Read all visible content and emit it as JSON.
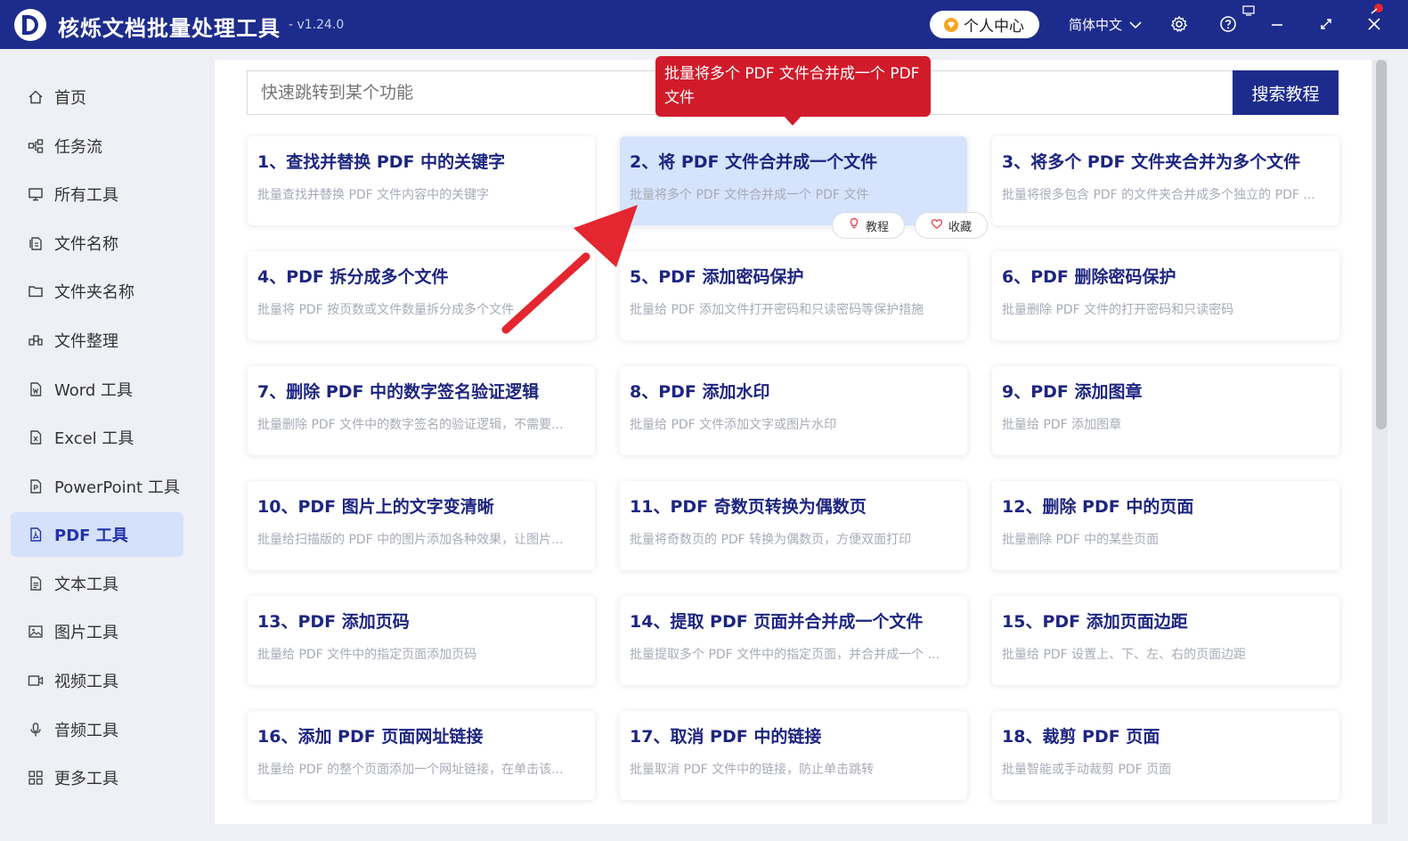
{
  "app": {
    "title": "核烁文档批量处理工具",
    "version": "- v1.24.0",
    "user_center": "个人中心",
    "language": "简体中文",
    "colors": {
      "brand": "#1d2c8c",
      "tooltip": "#d11b2b",
      "highlight": "#d5e3fc"
    }
  },
  "sidebar": {
    "items": [
      {
        "label": "首页",
        "icon": "home-icon"
      },
      {
        "label": "任务流",
        "icon": "workflow-icon"
      },
      {
        "label": "所有工具",
        "icon": "monitor-icon"
      },
      {
        "label": "文件名称",
        "icon": "file-name-icon"
      },
      {
        "label": "文件夹名称",
        "icon": "folder-icon"
      },
      {
        "label": "文件整理",
        "icon": "organize-icon"
      },
      {
        "label": "Word 工具",
        "icon": "word-icon"
      },
      {
        "label": "Excel 工具",
        "icon": "excel-icon"
      },
      {
        "label": "PowerPoint 工具",
        "icon": "powerpoint-icon"
      },
      {
        "label": "PDF 工具",
        "icon": "pdf-icon",
        "active": true
      },
      {
        "label": "文本工具",
        "icon": "text-icon"
      },
      {
        "label": "图片工具",
        "icon": "image-icon"
      },
      {
        "label": "视频工具",
        "icon": "video-icon"
      },
      {
        "label": "音频工具",
        "icon": "microphone-icon"
      },
      {
        "label": "更多工具",
        "icon": "grid-icon"
      }
    ]
  },
  "search": {
    "placeholder": "快速跳转到某个功能",
    "button_label": "搜索教程"
  },
  "tooltip": {
    "text": "批量将多个 PDF 文件合并成一个 PDF 文件"
  },
  "card_actions": {
    "tutorial_label": "教程",
    "favorite_label": "收藏"
  },
  "cards": [
    {
      "title": "1、查找并替换 PDF 中的关键字",
      "desc": "批量查找并替换 PDF 文件内容中的关键字"
    },
    {
      "title": "2、将 PDF 文件合并成一个文件",
      "desc": "批量将多个 PDF 文件合并成一个 PDF 文件",
      "highlighted": true
    },
    {
      "title": "3、将多个 PDF 文件夹合并为多个文件",
      "desc": "批量将很多包含 PDF 的文件夹合并成多个独立的 PDF ..."
    },
    {
      "title": "4、PDF 拆分成多个文件",
      "desc": "批量将 PDF 按页数或文件数量拆分成多个文件"
    },
    {
      "title": "5、PDF 添加密码保护",
      "desc": "批量给 PDF 添加文件打开密码和只读密码等保护措施"
    },
    {
      "title": "6、PDF 删除密码保护",
      "desc": "批量删除 PDF 文件的打开密码和只读密码"
    },
    {
      "title": "7、删除 PDF 中的数字签名验证逻辑",
      "desc": "批量删除 PDF 文件中的数字签名的验证逻辑，不需要..."
    },
    {
      "title": "8、PDF 添加水印",
      "desc": "批量给 PDF 文件添加文字或图片水印"
    },
    {
      "title": "9、PDF 添加图章",
      "desc": "批量给 PDF 添加图章"
    },
    {
      "title": "10、PDF 图片上的文字变清晰",
      "desc": "批量给扫描版的 PDF 中的图片添加各种效果，让图片..."
    },
    {
      "title": "11、PDF 奇数页转换为偶数页",
      "desc": "批量将奇数页的 PDF 转换为偶数页，方便双面打印"
    },
    {
      "title": "12、删除 PDF 中的页面",
      "desc": "批量删除 PDF 中的某些页面"
    },
    {
      "title": "13、PDF 添加页码",
      "desc": "批量给 PDF 文件中的指定页面添加页码"
    },
    {
      "title": "14、提取 PDF 页面并合并成一个文件",
      "desc": "批量提取多个 PDF 文件中的指定页面，并合并成一个 ..."
    },
    {
      "title": "15、PDF 添加页面边距",
      "desc": "批量给 PDF 设置上、下、左、右的页面边距"
    },
    {
      "title": "16、添加 PDF 页面网址链接",
      "desc": "批量给 PDF 的整个页面添加一个网址链接，在单击该..."
    },
    {
      "title": "17、取消 PDF 中的链接",
      "desc": "批量取消 PDF 文件中的链接，防止单击跳转"
    },
    {
      "title": "18、裁剪 PDF 页面",
      "desc": "批量智能或手动裁剪 PDF 页面"
    }
  ]
}
